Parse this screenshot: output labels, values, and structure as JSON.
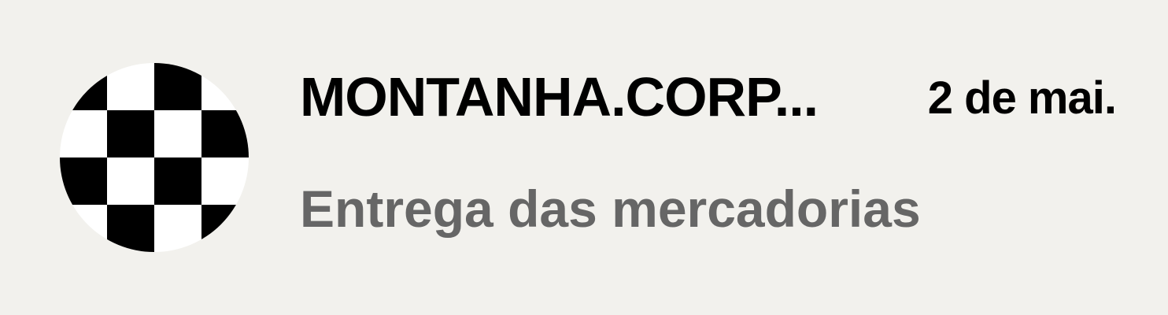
{
  "message": {
    "sender": "MONTANHA.CORP...",
    "date": "2 de mai.",
    "subject": "Entrega das mercadorias",
    "avatar_icon": "checkered-avatar-icon"
  },
  "colors": {
    "background": "#f2f1ed",
    "sender_text": "#000000",
    "subject_text": "#666666"
  }
}
